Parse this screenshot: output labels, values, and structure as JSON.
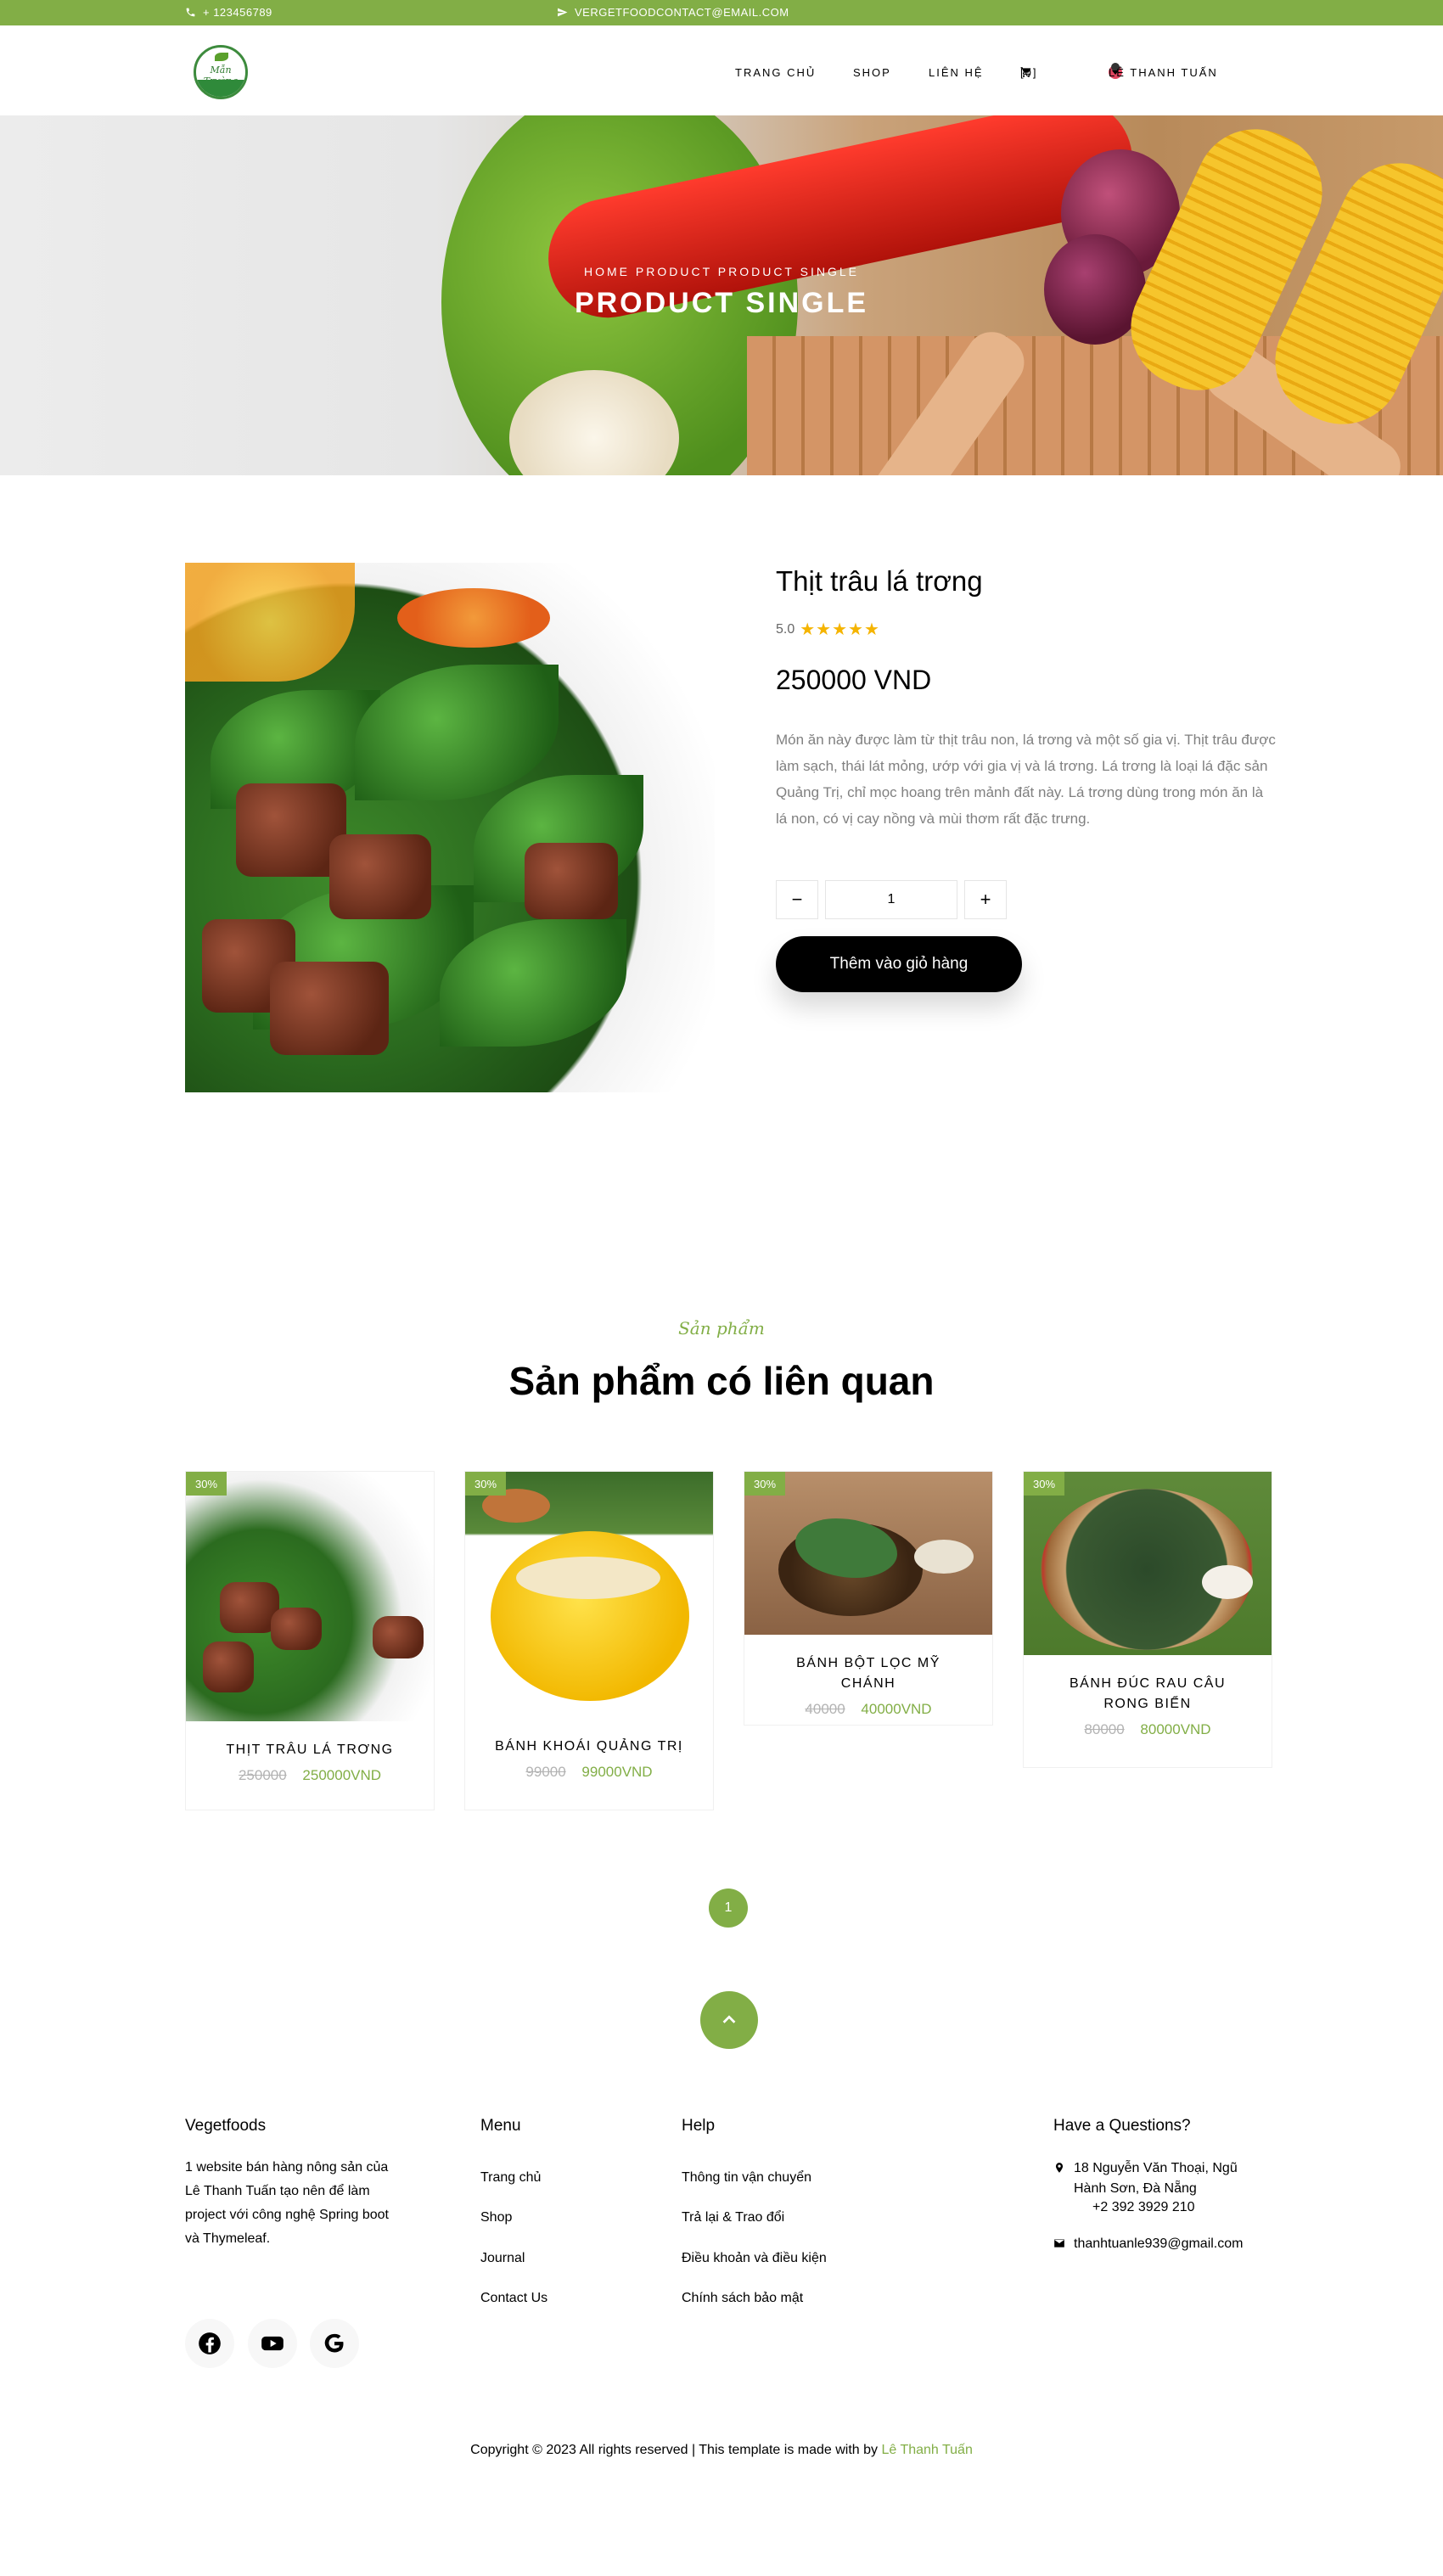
{
  "topbar": {
    "phone": "+ 123456789",
    "email": "VERGETFOODCONTACT@EMAIL.COM"
  },
  "nav": {
    "logo_text": "Mẫn Trường",
    "items": [
      "TRANG CHỦ",
      "SHOP",
      "LIÊN HỆ"
    ],
    "cart": "[0]",
    "user": "LÊ THANH TUẤN"
  },
  "hero": {
    "breadcrumb": "HOME  PRODUCT  PRODUCT SINGLE",
    "title": "PRODUCT SINGLE"
  },
  "product": {
    "name": "Thịt trâu lá trơng",
    "rating": "5.0",
    "stars": "★★★★★",
    "price": "250000 VND",
    "description": "Món ăn này được làm từ thịt trâu non, lá trơng và một số gia vị. Thịt trâu được làm sạch, thái lát mỏng, ướp với gia vị và lá trơng. Lá trơng là loại lá đặc sản Quảng Trị, chỉ mọc hoang trên mảnh đất này. Lá trơng dùng trong món ăn là lá non, có vị cay nồng và mùi thơm rất đặc trưng.",
    "quantity": "1",
    "minus": "−",
    "plus": "+",
    "add_to_cart": "Thêm vào giỏ hàng"
  },
  "related": {
    "subheading": "Sản phẩm",
    "heading": "Sản phẩm có liên quan",
    "items": [
      {
        "badge": "30%",
        "name": "THỊT TRÂU LÁ TRƠNG",
        "old_price": "250000",
        "new_price": "250000VND"
      },
      {
        "badge": "30%",
        "name": "BÁNH KHOÁI QUẢNG TRỊ",
        "old_price": "99000",
        "new_price": "99000VND"
      },
      {
        "badge": "30%",
        "name": "BÁNH BỘT LỌC MỸ CHÁNH",
        "old_price": "40000",
        "new_price": "40000VND"
      },
      {
        "badge": "30%",
        "name": "BÁNH ĐÚC RAU CÂU RONG BIỂN",
        "old_price": "80000",
        "new_price": "80000VND"
      }
    ],
    "page": "1"
  },
  "footer": {
    "about": {
      "title": "Vegetfoods",
      "text": "1 website bán hàng nông sản của Lê Thanh Tuấn tạo nên để làm project với công nghệ Spring boot và Thymeleaf."
    },
    "menu": {
      "title": "Menu",
      "links": [
        "Trang chủ",
        "Shop",
        "Journal",
        "Contact Us"
      ]
    },
    "help": {
      "title": "Help",
      "links": [
        "Thông tin vận chuyển",
        "Trả lại & Trao đổi",
        "Điều khoản và điều kiện",
        "Chính sách bảo mật"
      ]
    },
    "contact": {
      "title": "Have a Questions?",
      "address_line1": "18 Nguyễn Văn Thoại, Ngũ",
      "address_line2": "Hành Sơn, Đà Nẵng",
      "phone": "+2 392 3929 210",
      "email": "thanhtuanle939@gmail.com"
    },
    "social_icons": [
      "facebook-icon",
      "youtube-icon",
      "google-icon"
    ],
    "copyright": "Copyright © 2023 All rights reserved | This template is made with by",
    "author": "Lê Thanh Tuấn"
  },
  "colors": {
    "brand_green": "#82ae46",
    "button_black": "#000000",
    "star_gold": "#f5b400"
  }
}
